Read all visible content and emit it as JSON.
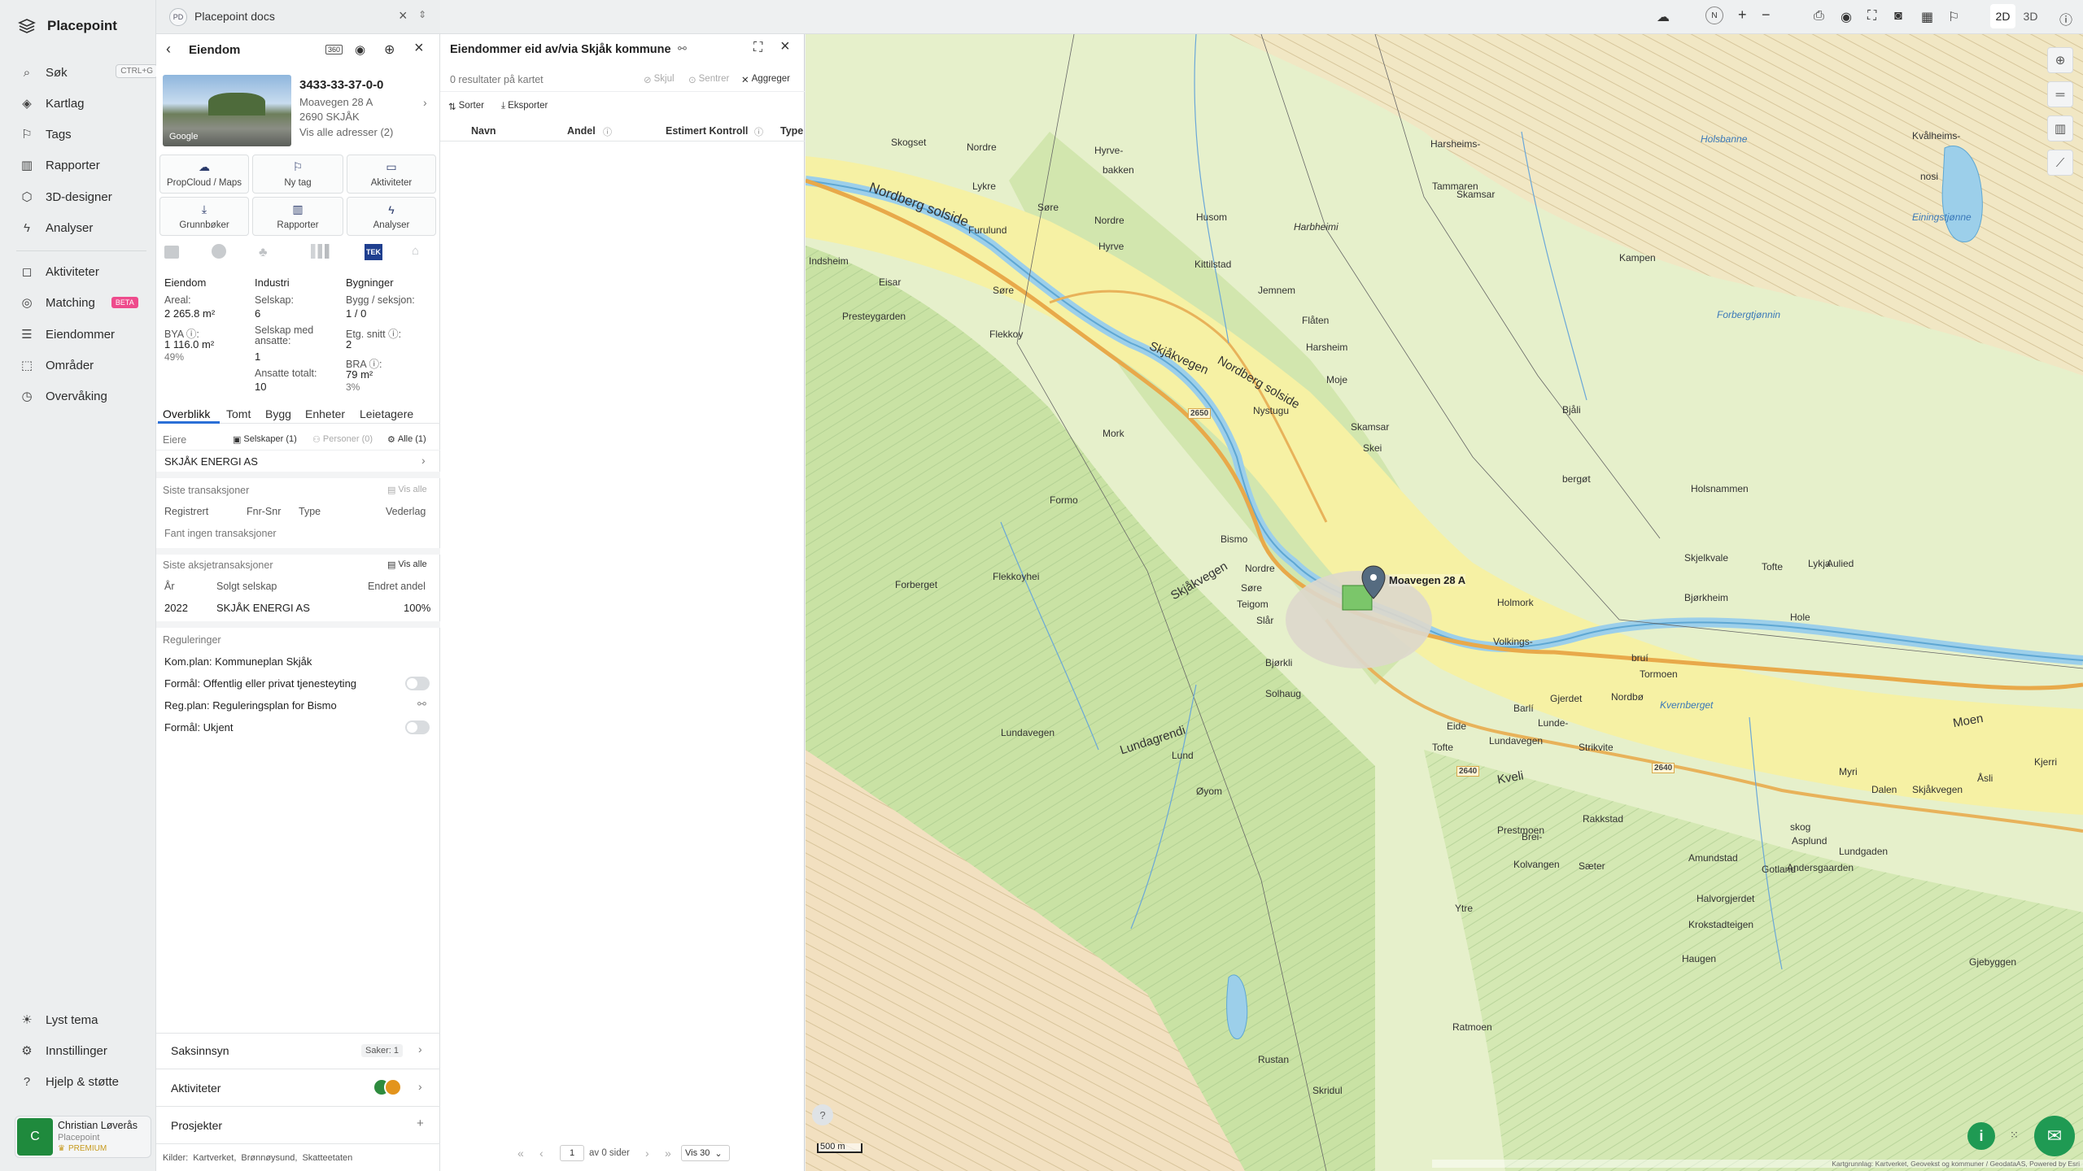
{
  "nav": {
    "brand": "Placepoint",
    "items": [
      {
        "label": "Søk",
        "icon": "search-icon",
        "shortcut": "CTRL+G"
      },
      {
        "label": "Kartlag",
        "icon": "layers-icon"
      },
      {
        "label": "Tags",
        "icon": "bookmark-icon"
      },
      {
        "label": "Rapporter",
        "icon": "chart-icon"
      },
      {
        "label": "3D-designer",
        "icon": "cube-icon"
      },
      {
        "label": "Analyser",
        "icon": "bolt-icon"
      },
      {
        "label": "Aktiviteter",
        "icon": "chat-icon"
      },
      {
        "label": "Matching",
        "icon": "target-icon",
        "badge": "BETA"
      },
      {
        "label": "Eiendommer",
        "icon": "list-icon"
      },
      {
        "label": "Områder",
        "icon": "area-icon"
      },
      {
        "label": "Overvåking",
        "icon": "clock-icon"
      }
    ],
    "bottom": [
      {
        "label": "Lyst tema",
        "icon": "sun-icon"
      },
      {
        "label": "Innstillinger",
        "icon": "gear-icon"
      },
      {
        "label": "Hjelp & støtte",
        "icon": "help-icon"
      }
    ],
    "user": {
      "initial": "C",
      "name": "Christian Løverås",
      "org": "Placepoint",
      "plan": "PREMIUM"
    }
  },
  "docs_tab": {
    "badge": "PD",
    "label": "Placepoint docs"
  },
  "property": {
    "header": "Eiendom",
    "id": "3433-33-37-0-0",
    "address1": "Moavegen 28 A",
    "address2": "2690 SKJÅK",
    "show_all": "Vis alle adresser (2)",
    "image_label": "Google",
    "actions": [
      "PropCloud / Maps",
      "Ny tag",
      "Aktiviteter",
      "Grunnbøker",
      "Rapporter",
      "Analyser"
    ],
    "tek_badge": "TEK",
    "col1": {
      "title": "Eiendom",
      "areal_label": "Areal:",
      "areal_value": "2 265.8 m²",
      "bya_label": "BYA ⓘ:",
      "bya_value": "1 116.0 m²",
      "bya_pct": "49%"
    },
    "col2": {
      "title": "Industri",
      "selskap_label": "Selskap:",
      "selskap_value": "6",
      "ansatte_label": "Selskap med ansatte:",
      "ansatte_value": "1",
      "totalt_label": "Ansatte totalt:",
      "totalt_value": "10"
    },
    "col3": {
      "title": "Bygninger",
      "bygg_label": "Bygg / seksjon:",
      "bygg_value": "1 / 0",
      "etg_label": "Etg. snitt ⓘ:",
      "etg_value": "2",
      "bra_label": "BRA ⓘ:",
      "bra_value": "79 m²",
      "bra_pct": "3%"
    },
    "tabs": [
      "Overblikk",
      "Tomt",
      "Bygg",
      "Enheter",
      "Leietagere"
    ],
    "owners": {
      "label": "Eiere",
      "selskaper": "Selskaper (1)",
      "personer": "Personer (0)",
      "alle": "Alle (1)",
      "owner": "SKJÅK ENERGI AS"
    },
    "transactions": {
      "title": "Siste transaksjoner",
      "vis_alle": "Vis alle",
      "cols": [
        "Registrert",
        "Fnr-Snr",
        "Type",
        "Vederlag"
      ],
      "empty": "Fant ingen transaksjoner"
    },
    "share_tx": {
      "title": "Siste aksjetransaksjoner",
      "vis_alle": "Vis alle",
      "cols": [
        "År",
        "Solgt selskap",
        "Endret andel"
      ],
      "row": [
        "2022",
        "SKJÅK ENERGI AS",
        "100%"
      ]
    },
    "reg": {
      "title": "Reguleringer",
      "items": [
        "Kom.plan: Kommuneplan Skjåk",
        "Formål: Offentlig eller privat tjenesteyting",
        "Reg.plan: Reguleringsplan for Bismo",
        "Formål: Ukjent"
      ]
    },
    "sections": {
      "saksinnsyn": "Saksinnsyn",
      "saker": "Saker: 1",
      "aktiviteter": "Aktiviteter",
      "prosjekter": "Prosjekter"
    },
    "sources": {
      "label": "Kilder:",
      "items": [
        "Kartverket,",
        "Brønnøysund,",
        "Skatteetaten"
      ]
    }
  },
  "owned": {
    "title": "Eiendommer eid av/via Skjåk kommune",
    "results": "0 resultater på kartet",
    "skjul": "Skjul",
    "sentrer": "Sentrer",
    "aggreger": "Aggreger",
    "sorter": "Sorter",
    "eksporter": "Eksporter",
    "cols": [
      "Navn",
      "Andel",
      "Estimert Kontroll",
      "Type"
    ],
    "pager": {
      "page": "1",
      "of": "av 0 sider",
      "per": "Vis 30"
    }
  },
  "topbar": {
    "mode2d": "2D",
    "mode3d": "3D"
  },
  "map": {
    "marker_label": "Moavegen 28 A",
    "scale": "500 m",
    "attribution": "Kartgrunnlag: Kartverket, Geovekst og kommuner / GeodataAS, Powered by Esri",
    "places": [
      "Skogset",
      "Nordre",
      "Hyrve-",
      "bakken",
      "Lykre",
      "Søre",
      "Nordre",
      "Husom",
      "Harsheims-",
      "Tammaren",
      "Skamsar",
      "Kvålheims-",
      "nosi",
      "Holsbanne",
      "Einingstjønne",
      "Kampen",
      "Forbergtjønnin",
      "Nordberg solside",
      "Furulund",
      "Hyrve",
      "Kittilstad",
      "Harbheimi",
      "Jemnem",
      "Flåten",
      "Indsheim",
      "Eisar",
      "Søre",
      "Presteygarden",
      "Flekkoy",
      "Skjåkvegen",
      "Nordberg solside",
      "Harsheim",
      "Skjåkvegen",
      "Moje",
      "Bjåli",
      "Nystugu",
      "Skamsar",
      "Skei",
      "bergøt",
      "Mork",
      "Holsnammen",
      "Formo",
      "Bismo",
      "Nordre",
      "Teigom",
      "Søre",
      "Slår",
      "Flekkoyhei",
      "Forberget",
      "Holmork",
      "Skjelkvale",
      "Tofte",
      "Lykja",
      "Aulied",
      "Hole",
      "Bjørkheim",
      "Bjørkli",
      "Solhaug",
      "Volkings-",
      "bruí",
      "Tormoen",
      "Nordbø",
      "Gjerdet",
      "Kvernberget",
      "Lundavegen",
      "Lundagrendi",
      "Eide",
      "Barlí",
      "Lunde-",
      "Strikvite",
      "Lund",
      "Tofte",
      "Lundavegen",
      "Kveli",
      "Øyom",
      "Myri",
      "Dalen",
      "Skjåkvegen",
      "Moen",
      "Kjerri",
      "Åsli",
      "Prestmoen",
      "Rakkstad",
      "Brei-",
      "skog",
      "Asplund",
      "Kolvangen",
      "Sæter",
      "Amundstad",
      "Gotland",
      "Andersgaarden",
      "Halvorgjerdet",
      "Ytre",
      "Krokstadteigen",
      "Haugen",
      "Lundgaden",
      "Gjebyggen",
      "Ratmoen",
      "Rustan",
      "Skridul"
    ],
    "road_labels": [
      "2650",
      "2640",
      "2640"
    ]
  }
}
